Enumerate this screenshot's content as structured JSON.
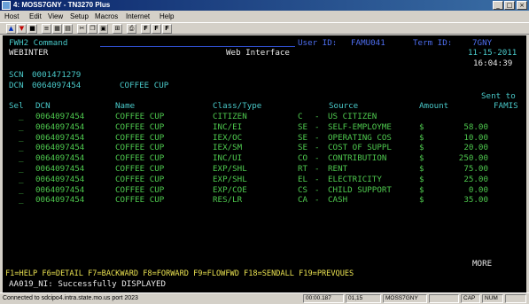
{
  "window": {
    "title": "4: MOSS7GNY - TN3270 Plus"
  },
  "menu": [
    "Host",
    "Edit",
    "View",
    "Setup",
    "Macros",
    "Internet",
    "Help"
  ],
  "toolbar": {
    "font_buttons": [
      "F",
      "F",
      "F"
    ]
  },
  "screen": {
    "command_label": "FWH2 Command",
    "user_label": "User ID:",
    "user_id": "FAMU041",
    "term_label": "Term ID:",
    "term_id": "7GNY",
    "system": "WEBINTER",
    "screen_title": "Web Interface",
    "date": "11-15-2011",
    "time": "16:04:39",
    "scn_label": "SCN",
    "scn": "0001471279",
    "dcn_label": "DCN",
    "dcn": "0064097454",
    "dcn_name": "COFFEE CUP",
    "sent_to_1": "Sent to",
    "sent_to_2": "FAMIS",
    "headers": {
      "sel": "Sel",
      "dcn": "DCN",
      "name": "Name",
      "class": "Class/Type",
      "source": "Source",
      "amount": "Amount"
    },
    "rows": [
      {
        "sel": "_",
        "dcn": "0064097454",
        "name": "COFFEE CUP",
        "class": "CITIZEN",
        "code": "C",
        "source": "US CITIZEN",
        "cur": "",
        "amount": ""
      },
      {
        "sel": "_",
        "dcn": "0064097454",
        "name": "COFFEE CUP",
        "class": "INC/EI",
        "code": "SE",
        "source": "SELF-EMPLOYME",
        "cur": "$",
        "amount": "58.00"
      },
      {
        "sel": "_",
        "dcn": "0064097454",
        "name": "COFFEE CUP",
        "class": "IEX/OC",
        "code": "SE",
        "source": "OPERATING COS",
        "cur": "$",
        "amount": "10.00"
      },
      {
        "sel": "_",
        "dcn": "0064097454",
        "name": "COFFEE CUP",
        "class": "IEX/SM",
        "code": "SE",
        "source": "COST OF SUPPL",
        "cur": "$",
        "amount": "20.00"
      },
      {
        "sel": "_",
        "dcn": "0064097454",
        "name": "COFFEE CUP",
        "class": "INC/UI",
        "code": "CO",
        "source": "CONTRIBUTION",
        "cur": "$",
        "amount": "250.00"
      },
      {
        "sel": "_",
        "dcn": "0064097454",
        "name": "COFFEE CUP",
        "class": "EXP/SHL",
        "code": "RT",
        "source": "RENT",
        "cur": "$",
        "amount": "75.00"
      },
      {
        "sel": "_",
        "dcn": "0064097454",
        "name": "COFFEE CUP",
        "class": "EXP/SHL",
        "code": "EL",
        "source": "ELECTRICITY",
        "cur": "$",
        "amount": "25.00"
      },
      {
        "sel": "_",
        "dcn": "0064097454",
        "name": "COFFEE CUP",
        "class": "EXP/COE",
        "code": "CS",
        "source": "CHILD SUPPORT",
        "cur": "$",
        "amount": "0.00"
      },
      {
        "sel": "_",
        "dcn": "0064097454",
        "name": "COFFEE CUP",
        "class": "RES/LR",
        "code": "CA",
        "source": "CASH",
        "cur": "$",
        "amount": "35.00"
      }
    ],
    "more": "MORE",
    "fkeys": "F1=HELP F6=DETAIL F7=BACKWARD F8=FORWARD F9=FLOWFWD F18=SENDALL F19=PREVQUES",
    "message": "AA019_NI: Successfully DISPLAYED"
  },
  "statusbar": {
    "connection": "Connected to sdcipo4.intra.state.mo.us port 2023",
    "timer": "00:00.187",
    "cursor": "01,15",
    "host": "MOSS7GNY",
    "caps": "CAP",
    "num": "NUM"
  }
}
